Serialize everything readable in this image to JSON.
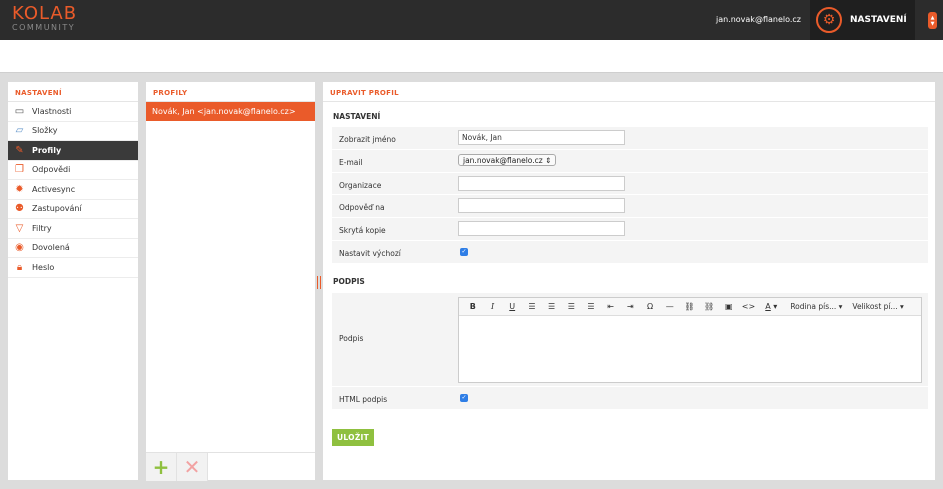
{
  "app": {
    "logo_line1": "KOLAB",
    "logo_line2": "COMMUNITY",
    "user_email": "jan.novak@flanelo.cz",
    "settings_tab_label": "NASTAVENÍ"
  },
  "settings_panel": {
    "title": "NASTAVENÍ",
    "items": [
      {
        "label": "Vlastnosti",
        "icon": "monitor-icon"
      },
      {
        "label": "Složky",
        "icon": "folder-icon"
      },
      {
        "label": "Profily",
        "icon": "profile-edit-icon",
        "active": true
      },
      {
        "label": "Odpovědi",
        "icon": "responses-icon"
      },
      {
        "label": "Activesync",
        "icon": "sync-gear-icon"
      },
      {
        "label": "Zastupování",
        "icon": "users-icon"
      },
      {
        "label": "Filtry",
        "icon": "filter-icon"
      },
      {
        "label": "Dovolená",
        "icon": "vacation-icon"
      },
      {
        "label": "Heslo",
        "icon": "lock-icon"
      }
    ]
  },
  "profiles_panel": {
    "title": "PROFILY",
    "profiles": [
      "Novák, Jan <jan.novak@flanelo.cz>"
    ],
    "add_label": "+",
    "delete_label": "✕"
  },
  "edit_panel": {
    "title": "UPRAVIT PROFIL",
    "settings_section": "NASTAVENÍ",
    "fields": {
      "display_name_label": "Zobrazit jméno",
      "display_name_value": "Novák, Jan",
      "email_label": "E-mail",
      "email_value": "jan.novak@flanelo.cz",
      "organization_label": "Organizace",
      "organization_value": "",
      "reply_to_label": "Odpověď na",
      "reply_to_value": "",
      "bcc_label": "Skrytá kopie",
      "bcc_value": "",
      "default_label": "Nastavit výchozí",
      "default_checked": true
    },
    "signature_section": "PODPIS",
    "signature_label": "Podpis",
    "html_signature_label": "HTML podpis",
    "html_signature_checked": true,
    "toolbar": {
      "font_family": "Rodina pís...",
      "font_size": "Velikost pí..."
    },
    "save_label": "ULOŽIT"
  }
}
